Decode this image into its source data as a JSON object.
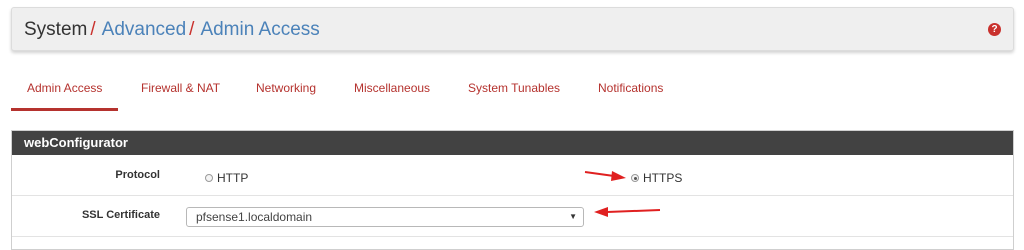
{
  "breadcrumb": {
    "root": "System",
    "separator": "/",
    "items": [
      "Advanced",
      "Admin Access"
    ]
  },
  "help_icon": "?",
  "tabs": [
    {
      "label": "Admin Access",
      "active": true
    },
    {
      "label": "Firewall & NAT",
      "active": false
    },
    {
      "label": "Networking",
      "active": false
    },
    {
      "label": "Miscellaneous",
      "active": false
    },
    {
      "label": "System Tunables",
      "active": false
    },
    {
      "label": "Notifications",
      "active": false
    }
  ],
  "panel": {
    "title": "webConfigurator",
    "protocol": {
      "label": "Protocol",
      "options": [
        {
          "label": "HTTP",
          "checked": false
        },
        {
          "label": "HTTPS",
          "checked": true
        }
      ]
    },
    "ssl_certificate": {
      "label": "SSL Certificate",
      "selected": "pfsense1.localdomain"
    }
  },
  "colors": {
    "accent_red": "#b5322e",
    "link_blue": "#4b82b9",
    "panel_heading_bg": "#424242",
    "annotation_arrow": "#e02020"
  }
}
